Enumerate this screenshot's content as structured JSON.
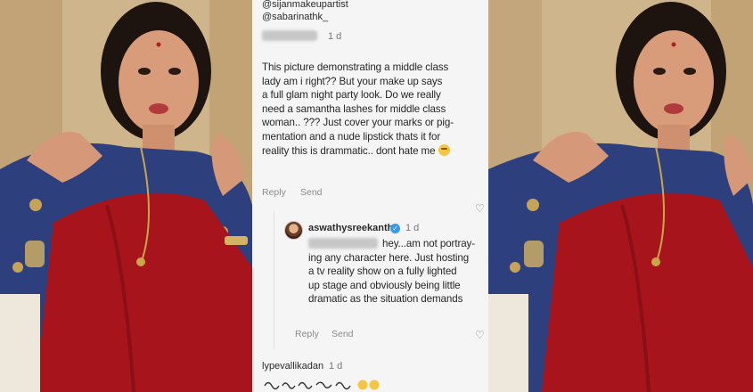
{
  "comment_thread": {
    "mentions": [
      "@sijanmakeupartist",
      "@sabarinathk_"
    ],
    "first_comment": {
      "time": "1 d",
      "lines": [
        "This picture demonstrating a middle class",
        "lady am i right?? But your make up says",
        "a full glam night party look. Do we really",
        "need a samantha lashes for middle class",
        "woman.. ??? Just cover your marks or pig-",
        "mentation and a nude lipstick thats it for",
        "reality this is drammatic.. dont hate me"
      ],
      "emoji": "grimacing-face",
      "reply_label": "Reply",
      "send_label": "Send"
    },
    "reply": {
      "username": "aswathysreekanth",
      "time": "1 d",
      "lines": [
        "hey...am not portray-",
        "ing any character here. Just hosting",
        "a tv reality show on a fully lighted",
        "up stage and obviously being little",
        "dramatic as the situation demands"
      ],
      "reply_label": "Reply",
      "send_label": "Send"
    },
    "third_comment": {
      "username": "lypevallikadan",
      "time": "1 d"
    }
  },
  "colors": {
    "saree": "#a8141c",
    "blouse": "#2d3f7c",
    "panel_bg": "#f5f5f5",
    "verified": "#3897f0"
  }
}
